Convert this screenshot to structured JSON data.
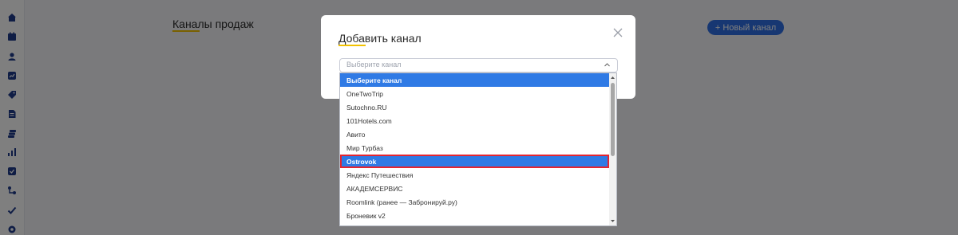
{
  "sidebar": {
    "icons": [
      "home-icon",
      "calendar-icon",
      "user-icon",
      "chart-box-icon",
      "tag-icon",
      "document-icon",
      "stack-icon",
      "bar-chart-icon",
      "checkbox-icon",
      "route-icon",
      "check-icon",
      "gear-icon"
    ]
  },
  "page": {
    "title": "Каналы продаж",
    "new_channel_button": "+ Новый канал"
  },
  "modal": {
    "title": "Добавить канал",
    "select_placeholder": "Выберите канал"
  },
  "dropdown": {
    "options": [
      "Выберите канал",
      "OneTwoTrip",
      "Sutochno.RU",
      "101Hotels.com",
      "Авито",
      "Мир Турбаз",
      "Ostrovok",
      "Яндекс Путешествия",
      "АКАДЕМСЕРВИС",
      "Roomlink (ранее — Забронируй.ру)",
      "Броневик v2"
    ],
    "highlighted_index": 6
  },
  "colors": {
    "accent": "#2f7ae5",
    "button_blue": "#2f6fe4",
    "underline_yellow": "#f2c100",
    "highlight_border": "#e5242f"
  }
}
